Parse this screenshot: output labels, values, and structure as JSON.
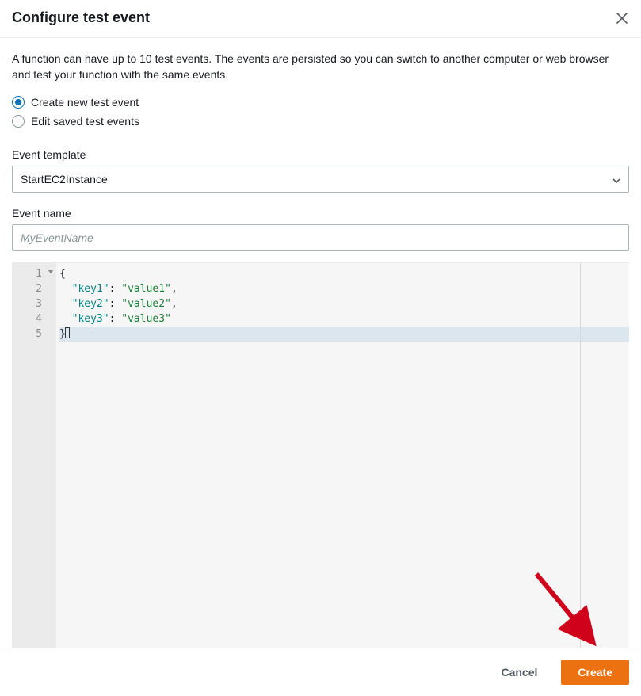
{
  "header": {
    "title": "Configure test event"
  },
  "description": "A function can have up to 10 test events. The events are persisted so you can switch to another computer or web browser and test your function with the same events.",
  "radios": {
    "create_label": "Create new test event",
    "edit_label": "Edit saved test events"
  },
  "template": {
    "label": "Event template",
    "value": "StartEC2Instance"
  },
  "event_name": {
    "label": "Event name",
    "placeholder": "MyEventName",
    "value": ""
  },
  "editor": {
    "lines": [
      {
        "n": "1",
        "raw": "{",
        "folds": true
      },
      {
        "n": "2",
        "key": "key1",
        "val": "value1",
        "comma": true
      },
      {
        "n": "3",
        "key": "key2",
        "val": "value2",
        "comma": true
      },
      {
        "n": "4",
        "key": "key3",
        "val": "value3",
        "comma": false
      },
      {
        "n": "5",
        "raw": "}",
        "active": true
      }
    ]
  },
  "footer": {
    "cancel": "Cancel",
    "create": "Create"
  }
}
